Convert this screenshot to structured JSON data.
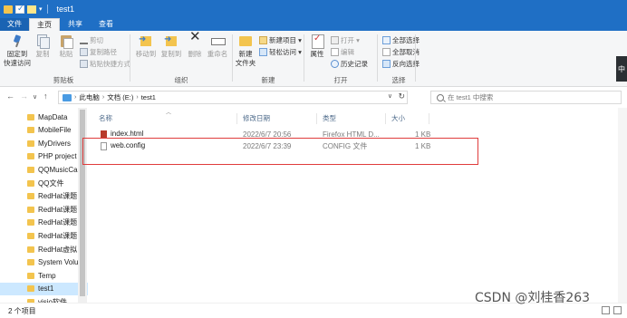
{
  "window": {
    "title": "test1"
  },
  "tabs": {
    "file": "文件",
    "home": "主页",
    "share": "共享",
    "view": "查看"
  },
  "ribbon": {
    "clipboard": {
      "label": "剪贴板",
      "pin": "固定到\n快速访问",
      "copy": "复制",
      "paste": "粘贴",
      "cut": "剪切",
      "copy_path": "复制路径",
      "paste_shortcut": "粘贴快捷方式"
    },
    "organize": {
      "label": "组织",
      "move_to": "移动到",
      "copy_to": "复制到",
      "delete": "删除",
      "rename": "重命名"
    },
    "new": {
      "label": "新建",
      "new_folder": "新建\n文件夹",
      "new_item": "新建项目 ▾",
      "easy_access": "轻松访问 ▾"
    },
    "open": {
      "label": "打开",
      "properties": "属性",
      "open": "打开 ▾",
      "edit": "编辑",
      "history": "历史记录"
    },
    "select": {
      "label": "选择",
      "select_all": "全部选择",
      "select_none": "全部取消",
      "invert": "反向选择"
    }
  },
  "address": {
    "crumbs": [
      "此电脑",
      "文档 (E:)",
      "test1"
    ],
    "search_placeholder": "在 test1 中搜索"
  },
  "navpane": {
    "items": [
      {
        "label": "MapData"
      },
      {
        "label": "MobileFile"
      },
      {
        "label": "MyDrivers"
      },
      {
        "label": "PHP project"
      },
      {
        "label": "QQMusicCac"
      },
      {
        "label": "QQ文件"
      },
      {
        "label": "RedHat课题"
      },
      {
        "label": "RedHat课题"
      },
      {
        "label": "RedHat课题"
      },
      {
        "label": "RedHat课题"
      },
      {
        "label": "RedHat虚拟"
      },
      {
        "label": "System Volu"
      },
      {
        "label": "Temp"
      },
      {
        "label": "test1"
      },
      {
        "label": "visio软件"
      }
    ]
  },
  "columns": {
    "name": "名称",
    "date": "修改日期",
    "type": "类型",
    "size": "大小"
  },
  "files": [
    {
      "name": "index.html",
      "date": "2022/6/7 20:56",
      "type": "Firefox HTML D...",
      "size": "1 KB"
    },
    {
      "name": "web.config",
      "date": "2022/6/7 23:39",
      "type": "CONFIG 文件",
      "size": "1 KB"
    }
  ],
  "status": {
    "count": "2 个项目"
  },
  "watermark": "CSDN @刘桂香263",
  "edge_tab": "中"
}
